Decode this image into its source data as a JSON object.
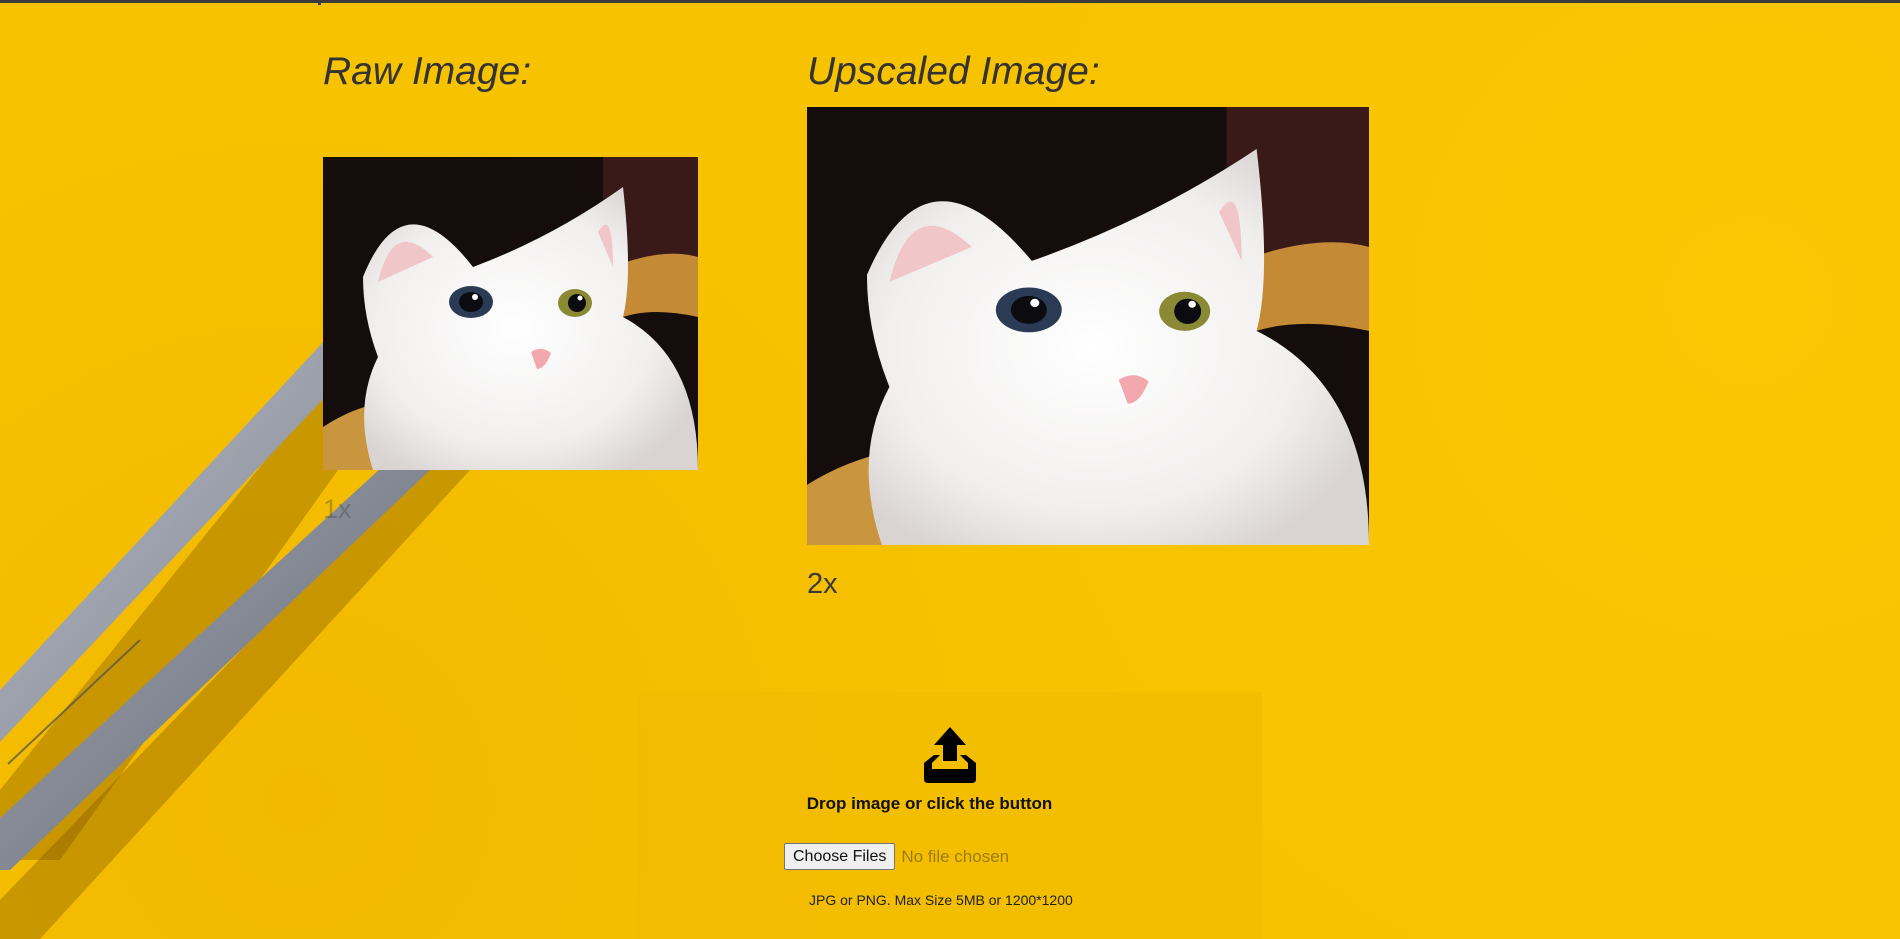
{
  "raw": {
    "title": "Raw Image:",
    "scale": "1x"
  },
  "upscaled": {
    "title": "Upscaled Image:",
    "scale": "2x"
  },
  "upload": {
    "drop_text": "Drop image or click the button",
    "choose_button": "Choose Files",
    "status": "No file chosen",
    "note": "JPG or PNG. Max Size 5MB or 1200*1200"
  },
  "icons": {
    "upload": "upload-tray-icon"
  },
  "colors": {
    "background": "#f7c200",
    "text": "#333333"
  }
}
